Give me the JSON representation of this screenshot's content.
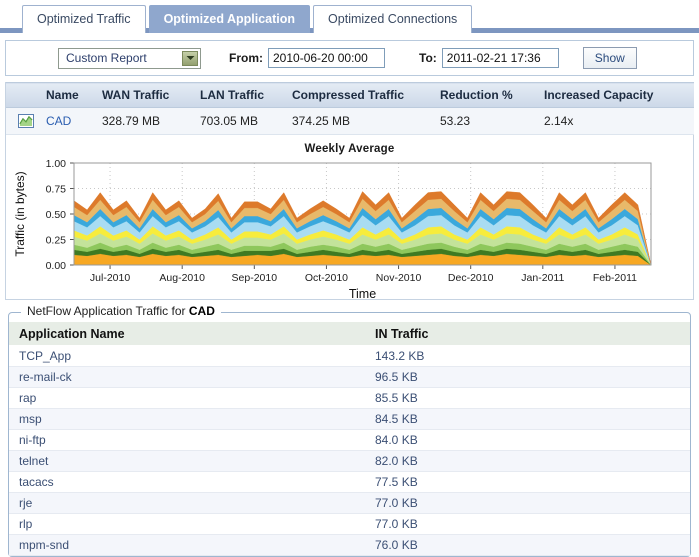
{
  "tabs": [
    {
      "label": "Optimized Traffic",
      "active": false
    },
    {
      "label": "Optimized Application",
      "active": true
    },
    {
      "label": "Optimized Connections",
      "active": false
    }
  ],
  "filterbar": {
    "report_select": {
      "value": "Custom Report",
      "arrow_icon": "chevron-down-icon"
    },
    "from_label": "From:",
    "from_value": "2010-06-20 00:00",
    "to_label": "To:",
    "to_value": "2011-02-21 17:36",
    "show_button": "Show"
  },
  "summary_table": {
    "columns": [
      "",
      "Name",
      "WAN Traffic",
      "LAN Traffic",
      "Compressed Traffic",
      "Reduction %",
      "Increased Capacity"
    ],
    "rows": [
      {
        "icon": "chart-icon",
        "name": "CAD",
        "wan_traffic": "328.79 MB",
        "lan_traffic": "703.05 MB",
        "compressed_traffic": "374.25 MB",
        "reduction_pct": "53.23",
        "increased_capacity": "2.14x"
      }
    ]
  },
  "chart_data": {
    "type": "area",
    "title": "Weekly Average",
    "xlabel": "Time",
    "ylabel": "Traffic (in bytes)",
    "ylim": [
      0,
      1.0
    ],
    "yticks": [
      "0.00",
      "0.25",
      "0.50",
      "0.75",
      "1.00"
    ],
    "ytick_values": [
      0.0,
      0.25,
      0.5,
      0.75,
      1.0
    ],
    "xticks": [
      "Jul-2010",
      "Aug-2010",
      "Sep-2010",
      "Oct-2010",
      "Nov-2010",
      "Dec-2010",
      "Jan-2011",
      "Feb-2011"
    ],
    "grid": true,
    "legend": "none",
    "stacked": true,
    "colors": [
      "#f7a823",
      "#3f7a22",
      "#8ec75c",
      "#c3e39a",
      "#f7ec3c",
      "#a9dcf2",
      "#3aa8dc",
      "#e8b96a",
      "#dd7a2b"
    ],
    "series": [
      {
        "name": "layer-1",
        "color": "#f7a823",
        "values": [
          0.1,
          0.09,
          0.11,
          0.09,
          0.1,
          0.08,
          0.11,
          0.09,
          0.1,
          0.08,
          0.09,
          0.1,
          0.08,
          0.09,
          0.1,
          0.09,
          0.11,
          0.08,
          0.09,
          0.1,
          0.09,
          0.08,
          0.1,
          0.09,
          0.1,
          0.08,
          0.09,
          0.1,
          0.11,
          0.09,
          0.08,
          0.1,
          0.09,
          0.11,
          0.1,
          0.09,
          0.08,
          0.1,
          0.09,
          0.1,
          0.08,
          0.09,
          0.1,
          0.09,
          0.0
        ]
      },
      {
        "name": "layer-2",
        "color": "#3f7a22",
        "values": [
          0.05,
          0.04,
          0.05,
          0.04,
          0.05,
          0.03,
          0.05,
          0.04,
          0.05,
          0.03,
          0.04,
          0.05,
          0.03,
          0.05,
          0.04,
          0.05,
          0.05,
          0.03,
          0.04,
          0.05,
          0.04,
          0.03,
          0.05,
          0.04,
          0.05,
          0.03,
          0.04,
          0.05,
          0.05,
          0.04,
          0.03,
          0.05,
          0.04,
          0.05,
          0.05,
          0.04,
          0.03,
          0.05,
          0.04,
          0.05,
          0.03,
          0.04,
          0.05,
          0.04,
          0.0
        ]
      },
      {
        "name": "layer-3",
        "color": "#8ec75c",
        "values": [
          0.05,
          0.04,
          0.06,
          0.04,
          0.05,
          0.04,
          0.06,
          0.04,
          0.05,
          0.04,
          0.05,
          0.06,
          0.04,
          0.05,
          0.05,
          0.04,
          0.06,
          0.04,
          0.05,
          0.05,
          0.05,
          0.04,
          0.06,
          0.05,
          0.06,
          0.04,
          0.05,
          0.06,
          0.06,
          0.05,
          0.04,
          0.06,
          0.05,
          0.06,
          0.06,
          0.05,
          0.04,
          0.06,
          0.05,
          0.06,
          0.04,
          0.05,
          0.06,
          0.05,
          0.0
        ]
      },
      {
        "name": "layer-4",
        "color": "#c3e39a",
        "values": [
          0.08,
          0.07,
          0.09,
          0.07,
          0.08,
          0.06,
          0.09,
          0.07,
          0.08,
          0.06,
          0.07,
          0.09,
          0.06,
          0.08,
          0.08,
          0.07,
          0.09,
          0.06,
          0.07,
          0.08,
          0.07,
          0.06,
          0.09,
          0.07,
          0.09,
          0.06,
          0.07,
          0.09,
          0.09,
          0.07,
          0.06,
          0.09,
          0.07,
          0.09,
          0.09,
          0.07,
          0.06,
          0.09,
          0.07,
          0.09,
          0.06,
          0.07,
          0.09,
          0.07,
          0.0
        ]
      },
      {
        "name": "layer-5",
        "color": "#f7ec3c",
        "values": [
          0.06,
          0.05,
          0.07,
          0.05,
          0.06,
          0.04,
          0.07,
          0.05,
          0.06,
          0.04,
          0.05,
          0.07,
          0.04,
          0.06,
          0.06,
          0.05,
          0.07,
          0.04,
          0.05,
          0.06,
          0.05,
          0.04,
          0.07,
          0.05,
          0.07,
          0.04,
          0.05,
          0.07,
          0.07,
          0.05,
          0.04,
          0.07,
          0.05,
          0.07,
          0.07,
          0.05,
          0.04,
          0.07,
          0.05,
          0.07,
          0.04,
          0.05,
          0.07,
          0.05,
          0.0
        ]
      },
      {
        "name": "layer-6",
        "color": "#a9dcf2",
        "values": [
          0.09,
          0.08,
          0.1,
          0.08,
          0.09,
          0.07,
          0.1,
          0.08,
          0.09,
          0.07,
          0.08,
          0.1,
          0.07,
          0.09,
          0.09,
          0.08,
          0.1,
          0.07,
          0.08,
          0.09,
          0.08,
          0.07,
          0.12,
          0.09,
          0.11,
          0.07,
          0.09,
          0.11,
          0.11,
          0.09,
          0.07,
          0.11,
          0.09,
          0.11,
          0.11,
          0.09,
          0.07,
          0.11,
          0.09,
          0.11,
          0.07,
          0.09,
          0.11,
          0.09,
          0.0
        ]
      },
      {
        "name": "layer-7",
        "color": "#3aa8dc",
        "values": [
          0.06,
          0.05,
          0.07,
          0.05,
          0.06,
          0.04,
          0.07,
          0.05,
          0.06,
          0.04,
          0.05,
          0.07,
          0.04,
          0.06,
          0.06,
          0.05,
          0.07,
          0.04,
          0.05,
          0.06,
          0.05,
          0.04,
          0.07,
          0.06,
          0.07,
          0.04,
          0.06,
          0.07,
          0.07,
          0.06,
          0.04,
          0.07,
          0.06,
          0.07,
          0.07,
          0.06,
          0.04,
          0.07,
          0.06,
          0.07,
          0.04,
          0.06,
          0.07,
          0.06,
          0.0
        ]
      },
      {
        "name": "layer-8",
        "color": "#e8b96a",
        "values": [
          0.08,
          0.07,
          0.09,
          0.07,
          0.08,
          0.06,
          0.09,
          0.07,
          0.08,
          0.06,
          0.07,
          0.09,
          0.06,
          0.08,
          0.08,
          0.07,
          0.09,
          0.06,
          0.07,
          0.08,
          0.07,
          0.06,
          0.09,
          0.08,
          0.09,
          0.06,
          0.08,
          0.09,
          0.09,
          0.08,
          0.06,
          0.09,
          0.08,
          0.09,
          0.09,
          0.08,
          0.06,
          0.09,
          0.08,
          0.09,
          0.06,
          0.08,
          0.09,
          0.08,
          0.0
        ]
      },
      {
        "name": "layer-9",
        "color": "#dd7a2b",
        "values": [
          0.06,
          0.05,
          0.07,
          0.05,
          0.06,
          0.04,
          0.07,
          0.05,
          0.06,
          0.04,
          0.05,
          0.07,
          0.04,
          0.06,
          0.06,
          0.05,
          0.07,
          0.04,
          0.05,
          0.06,
          0.05,
          0.04,
          0.07,
          0.06,
          0.07,
          0.04,
          0.06,
          0.07,
          0.07,
          0.06,
          0.04,
          0.07,
          0.06,
          0.07,
          0.07,
          0.06,
          0.04,
          0.07,
          0.06,
          0.07,
          0.04,
          0.06,
          0.07,
          0.06,
          0.0
        ]
      }
    ]
  },
  "app_panel": {
    "legend_prefix": "NetFlow Application Traffic for",
    "legend_name": "CAD",
    "columns": [
      "Application Name",
      "IN Traffic"
    ],
    "rows": [
      {
        "name": "TCP_App",
        "in_traffic": "143.2 KB"
      },
      {
        "name": "re-mail-ck",
        "in_traffic": "96.5 KB"
      },
      {
        "name": "rap",
        "in_traffic": "85.5 KB"
      },
      {
        "name": "msp",
        "in_traffic": "84.5 KB"
      },
      {
        "name": "ni-ftp",
        "in_traffic": "84.0 KB"
      },
      {
        "name": "telnet",
        "in_traffic": "82.0 KB"
      },
      {
        "name": "tacacs",
        "in_traffic": "77.5 KB"
      },
      {
        "name": "rje",
        "in_traffic": "77.0 KB"
      },
      {
        "name": "rlp",
        "in_traffic": "77.0 KB"
      },
      {
        "name": "mpm-snd",
        "in_traffic": "76.0 KB"
      }
    ]
  }
}
